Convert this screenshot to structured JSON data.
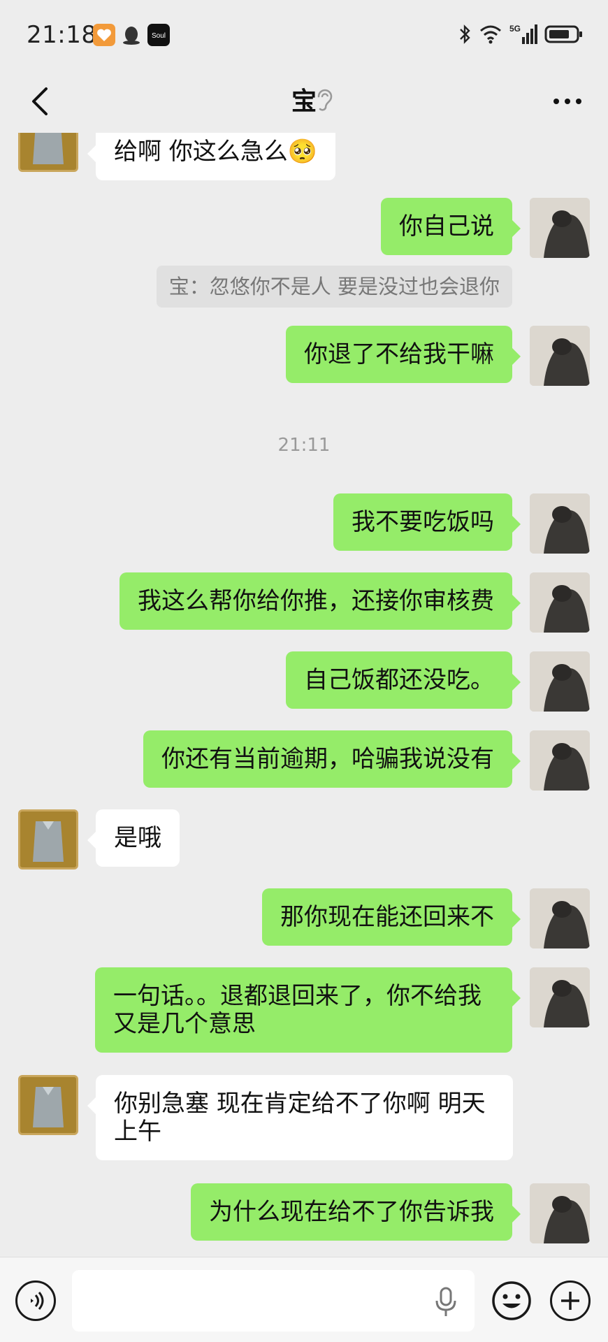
{
  "status_bar": {
    "time": "21:18",
    "app_icons": [
      "heart-app-icon",
      "qq-penguin-icon",
      "soul-app-icon"
    ],
    "soul_label": "Soul",
    "network": "5G",
    "icons": [
      "bluetooth-icon",
      "wifi-icon",
      "signal-icon",
      "battery-icon"
    ]
  },
  "header": {
    "title": "宝",
    "back_icon": "chevron-left-icon",
    "ear_icon": "ear-icon",
    "more_icon": "more-dots-icon"
  },
  "colors": {
    "outgoing_bubble": "#95ec69",
    "incoming_bubble": "#ffffff",
    "background": "#ededed"
  },
  "messages": [
    {
      "type": "in",
      "text": "给啊 你这么急么🥺"
    },
    {
      "type": "out",
      "text": "你自己说"
    },
    {
      "type": "quote",
      "text": "宝：忽悠你不是人 要是没过也会退你"
    },
    {
      "type": "out",
      "text": "你退了不给我干嘛"
    },
    {
      "type": "time",
      "text": "21:11"
    },
    {
      "type": "out",
      "text": "我不要吃饭吗"
    },
    {
      "type": "out",
      "text": "我这么帮你给你推，还接你审核费"
    },
    {
      "type": "out",
      "text": "自己饭都还没吃。"
    },
    {
      "type": "out",
      "text": "你还有当前逾期，哈骗我说没有"
    },
    {
      "type": "in",
      "text": "是哦"
    },
    {
      "type": "out",
      "text": "那你现在能还回来不"
    },
    {
      "type": "out",
      "text": "一句话。。退都退回来了，你不给我又是几个意思"
    },
    {
      "type": "in",
      "text": "你别急塞 现在肯定给不了你啊 明天上午"
    },
    {
      "type": "out",
      "text": "为什么现在给不了你告诉我"
    }
  ],
  "input_bar": {
    "value": "",
    "icons": [
      "voice-icon",
      "microphone-icon",
      "emoji-icon",
      "plus-icon"
    ]
  }
}
